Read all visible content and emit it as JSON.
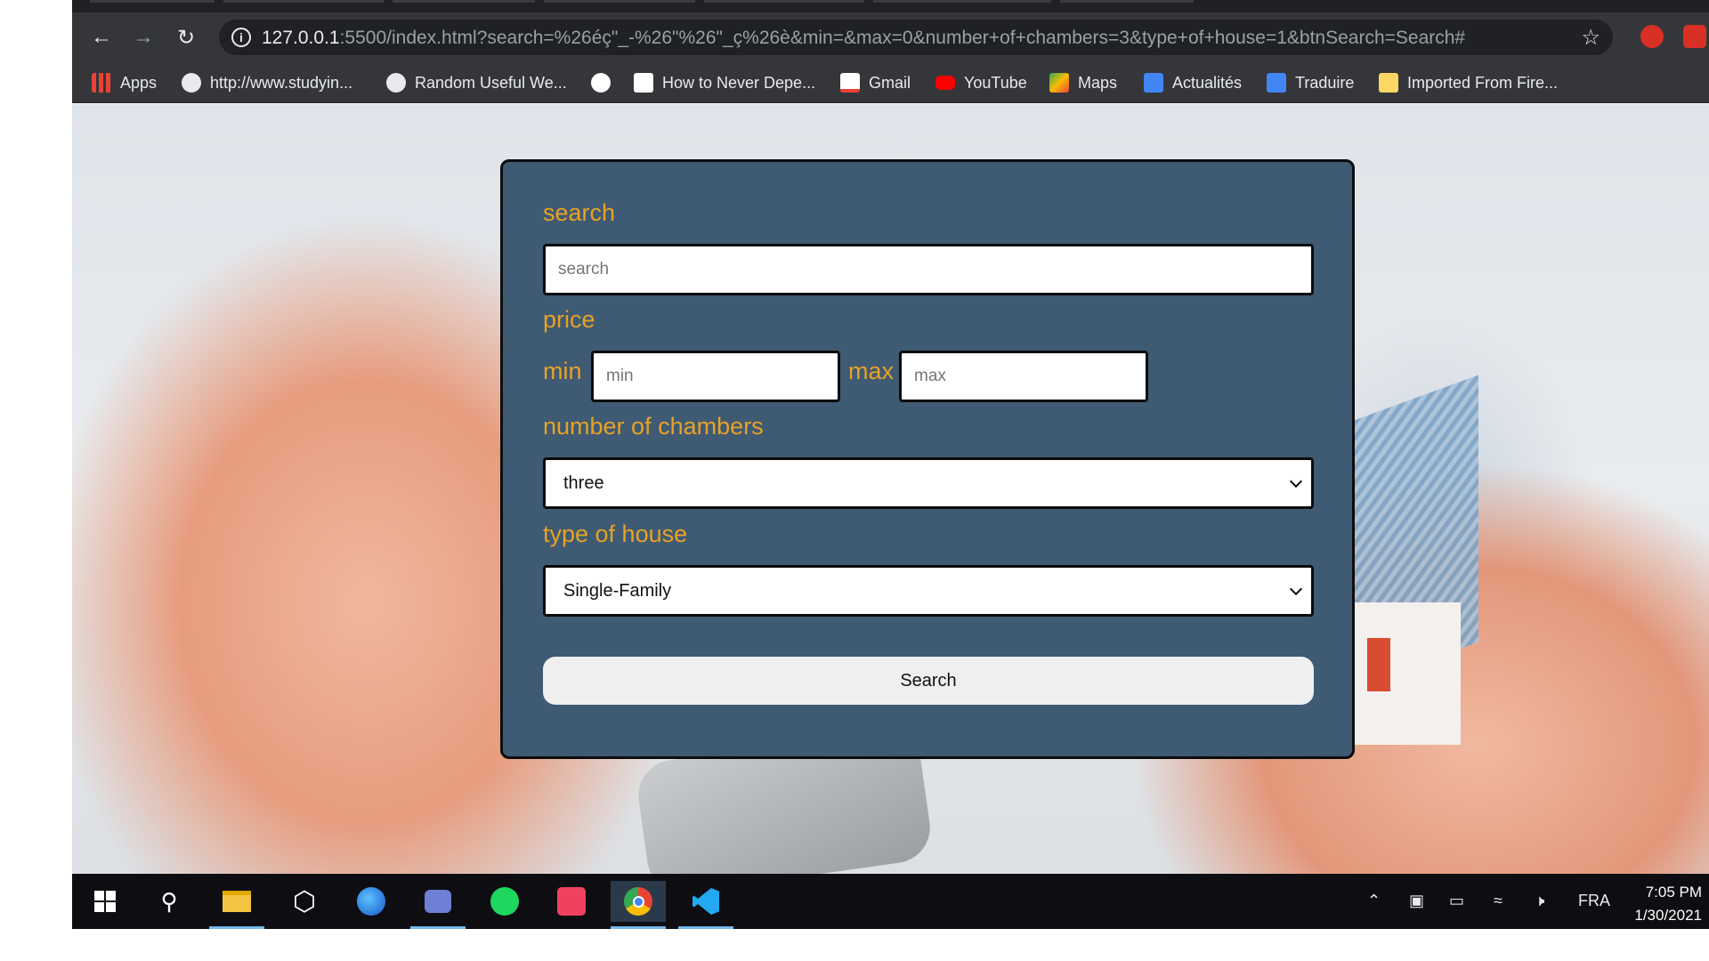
{
  "browser": {
    "url_host": "127.0.0.1",
    "url_rest": ":5500/index.html?search=%26éç\"_-%26\"%26\"_ç%26è&min=&max=0&number+of+chambers=3&type+of+house=1&btnSearch=Search#",
    "bookmarks": [
      {
        "label": "Apps",
        "icon": "apps-grid-icon",
        "color": "#ea4335"
      },
      {
        "label": "http://www.studyin...",
        "icon": "globe-icon",
        "color": "#e8eaed"
      },
      {
        "label": "Random Useful We...",
        "icon": "globe-icon",
        "color": "#e8eaed"
      },
      {
        "label": "",
        "icon": "google-icon",
        "color": "#ffffff"
      },
      {
        "label": "How to Never Depe...",
        "icon": "page-icon",
        "color": "#ffffff"
      },
      {
        "label": "Gmail",
        "icon": "gmail-icon",
        "color": "#ea4335"
      },
      {
        "label": "YouTube",
        "icon": "youtube-icon",
        "color": "#ff0000"
      },
      {
        "label": "Maps",
        "icon": "maps-icon",
        "color": "#34a853"
      },
      {
        "label": "Actualités",
        "icon": "news-icon",
        "color": "#4285f4"
      },
      {
        "label": "Traduire",
        "icon": "translate-icon",
        "color": "#4285f4"
      },
      {
        "label": "Imported From Fire...",
        "icon": "folder-icon",
        "color": "#fdd663"
      }
    ]
  },
  "form": {
    "search_label": "search",
    "search_placeholder": "search",
    "price_label": "price",
    "min_label": "min",
    "min_placeholder": "min",
    "max_label": "max",
    "max_placeholder": "max",
    "chambers_label": "number of chambers",
    "chambers_value": "three",
    "type_label": "type of house",
    "type_value": "Single-Family",
    "search_button": "Search"
  },
  "colors": {
    "panel_bg": "#3f5a73",
    "label_orange": "#e7a226",
    "browser_dark": "#35363a"
  },
  "taskbar": {
    "language": "FRA",
    "time": "7:05 PM",
    "date": "1/30/2021"
  }
}
